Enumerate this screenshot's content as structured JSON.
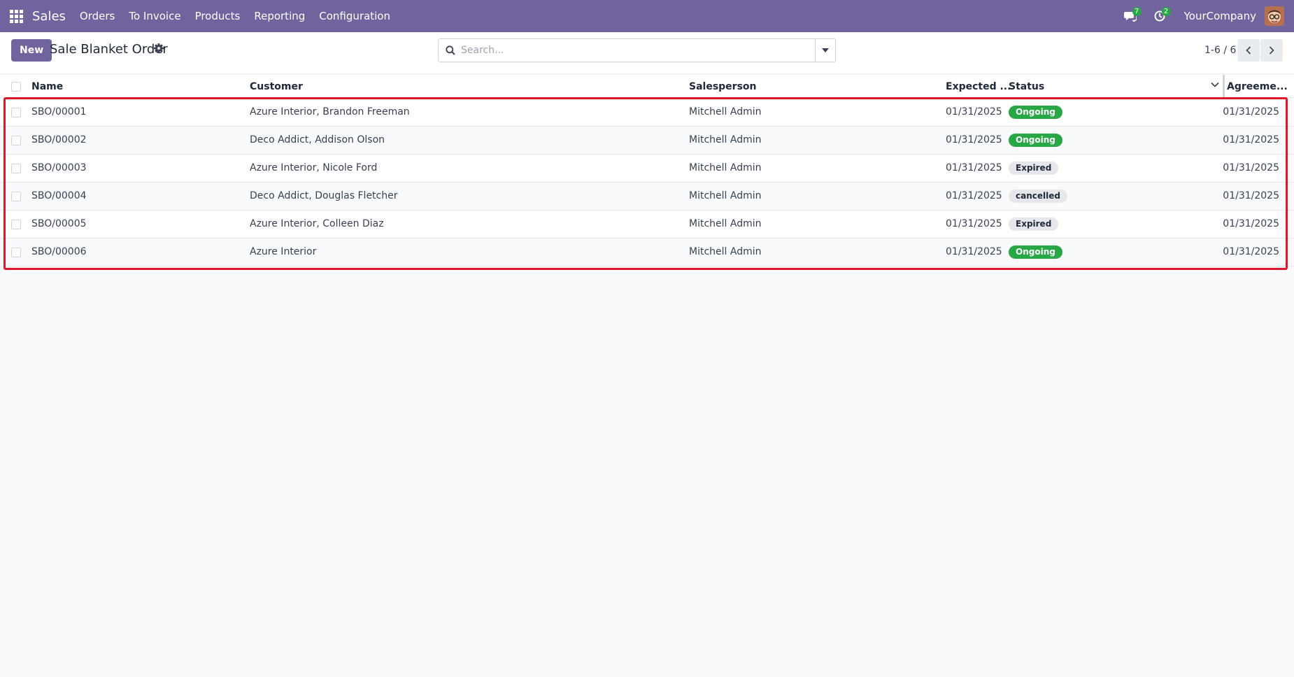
{
  "navbar": {
    "app_name": "Sales",
    "menu": [
      "Orders",
      "To Invoice",
      "Products",
      "Reporting",
      "Configuration"
    ],
    "messages_count": "7",
    "activities_count": "2",
    "company": "YourCompany",
    "color": "#71639e"
  },
  "control_panel": {
    "new_label": "New",
    "title": "Sale Blanket Order",
    "search_placeholder": "Search...",
    "pager_text": "1-6 / 6"
  },
  "table": {
    "columns": [
      "Name",
      "Customer",
      "Salesperson",
      "Expected ...",
      "Status",
      "Agreeme..."
    ],
    "rows": [
      {
        "name": "SBO/00001",
        "customer": "Azure Interior, Brandon Freeman",
        "salesperson": "Mitchell Admin",
        "expected": "01/31/2025",
        "status": "Ongoing",
        "status_style": "ongoing",
        "agreement": "01/31/2025"
      },
      {
        "name": "SBO/00002",
        "customer": "Deco Addict, Addison Olson",
        "salesperson": "Mitchell Admin",
        "expected": "01/31/2025",
        "status": "Ongoing",
        "status_style": "ongoing",
        "agreement": "01/31/2025"
      },
      {
        "name": "SBO/00003",
        "customer": "Azure Interior, Nicole Ford",
        "salesperson": "Mitchell Admin",
        "expected": "01/31/2025",
        "status": "Expired",
        "status_style": "grey",
        "agreement": "01/31/2025"
      },
      {
        "name": "SBO/00004",
        "customer": "Deco Addict, Douglas Fletcher",
        "salesperson": "Mitchell Admin",
        "expected": "01/31/2025",
        "status": "cancelled",
        "status_style": "grey",
        "agreement": "01/31/2025"
      },
      {
        "name": "SBO/00005",
        "customer": "Azure Interior, Colleen Diaz",
        "salesperson": "Mitchell Admin",
        "expected": "01/31/2025",
        "status": "Expired",
        "status_style": "grey",
        "agreement": "01/31/2025"
      },
      {
        "name": "SBO/00006",
        "customer": "Azure Interior",
        "salesperson": "Mitchell Admin",
        "expected": "01/31/2025",
        "status": "Ongoing",
        "status_style": "ongoing",
        "agreement": "01/31/2025"
      }
    ]
  }
}
